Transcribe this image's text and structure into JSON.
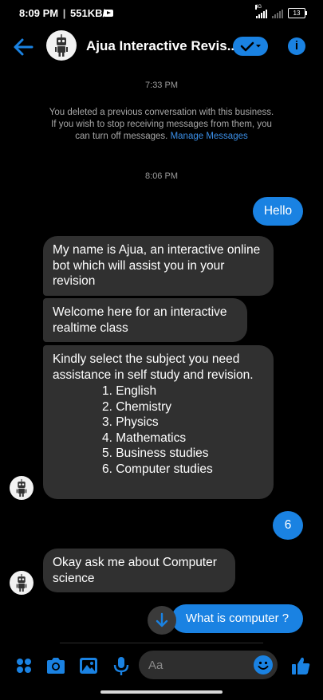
{
  "status_bar": {
    "time": "8:09 PM",
    "speed": "551KB/s",
    "network": "4G",
    "battery": "13"
  },
  "header": {
    "title": "Ajua Interactive Revis..."
  },
  "conversation": {
    "timestamp_1": "7:33 PM",
    "notice_text": "You deleted a previous conversation with this business. If you wish to stop receiving messages from them, you can turn off messages.",
    "notice_link": "Manage Messages",
    "timestamp_2": "8:06 PM",
    "messages": [
      {
        "from": "me",
        "text": "Hello"
      },
      {
        "from": "bot",
        "text": "My name is Ajua, an interactive online bot which will assist you in your revision"
      },
      {
        "from": "bot",
        "text": "Welcome here for an interactive realtime class"
      },
      {
        "from": "bot",
        "text": "Kindly select the subject you need assistance in self study and revision.",
        "options": [
          "1. English",
          "2. Chemistry",
          "3. Physics",
          "4. Mathematics",
          "5. Business studies",
          "6. Computer studies"
        ]
      },
      {
        "from": "me",
        "text": "6"
      },
      {
        "from": "bot",
        "text": "Okay ask me about Computer science"
      },
      {
        "from": "me",
        "text": "What is computer ?"
      }
    ]
  },
  "composer": {
    "placeholder": "Aa"
  },
  "colors": {
    "accent": "#1a82e2",
    "incoming_bubble": "#303030",
    "background": "#000000"
  },
  "icons": [
    "back-arrow-icon",
    "check-icon",
    "info-icon",
    "apps-icon",
    "camera-icon",
    "image-icon",
    "microphone-icon",
    "emoji-icon",
    "thumbs-up-icon",
    "arrow-down-icon",
    "bot-avatar"
  ]
}
